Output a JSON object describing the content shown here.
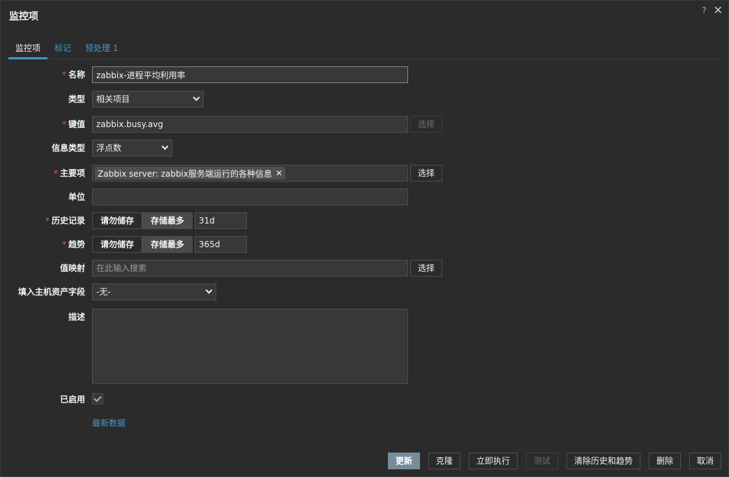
{
  "dialog": {
    "title": "监控项"
  },
  "tabs": [
    {
      "label": "监控项"
    },
    {
      "label": "标记"
    },
    {
      "label": "预处理 1"
    }
  ],
  "fields": {
    "name": {
      "label": "名称",
      "value": "zabbix-进程平均利用率"
    },
    "type": {
      "label": "类型",
      "value": "相关项目"
    },
    "key": {
      "label": "键值",
      "value": "zabbix.busy.avg",
      "select_label": "选择"
    },
    "info_type": {
      "label": "信息类型",
      "value": "浮点数"
    },
    "master_item": {
      "label": "主要项",
      "chip": "Zabbix server: zabbix服务端运行的各种信息",
      "select_label": "选择"
    },
    "units": {
      "label": "单位",
      "value": ""
    },
    "history": {
      "label": "历史记录",
      "option_off": "请勿储存",
      "option_on": "存储最多",
      "value": "31d"
    },
    "trends": {
      "label": "趋势",
      "option_off": "请勿储存",
      "option_on": "存储最多",
      "value": "365d"
    },
    "value_map": {
      "label": "值映射",
      "placeholder": "在此输入搜索",
      "select_label": "选择"
    },
    "inventory": {
      "label": "填入主机资产字段",
      "value": "-无-"
    },
    "description": {
      "label": "描述",
      "value": ""
    },
    "enabled": {
      "label": "已启用",
      "checked": true
    },
    "latest_data_link": "最新数据"
  },
  "footer": {
    "update": "更新",
    "clone": "克隆",
    "execute_now": "立即执行",
    "test": "测试",
    "clear_history": "清除历史和趋势",
    "delete": "删除",
    "cancel": "取消"
  },
  "colors": {
    "accent": "#4796c4",
    "required": "#e45959",
    "primary_button": "#768d99"
  }
}
